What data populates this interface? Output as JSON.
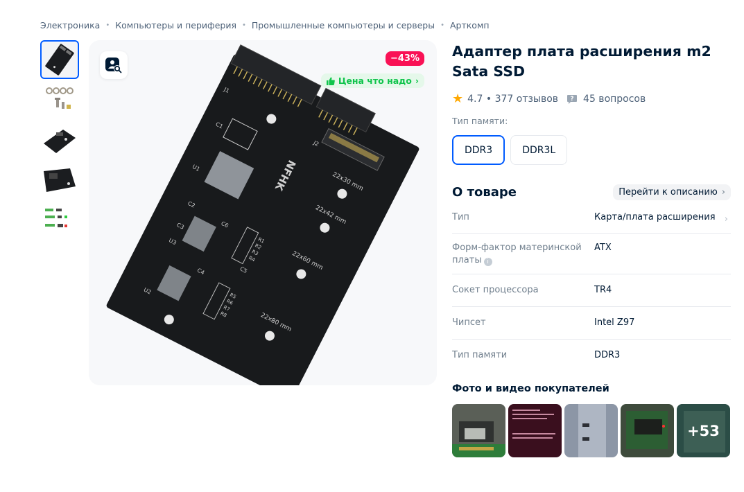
{
  "breadcrumb": [
    "Электроника",
    "Компьютеры и периферия",
    "Промышленные компьютеры и серверы",
    "Арткомп"
  ],
  "gallery": {
    "discount": "−43%",
    "good_price": "Цена что надо",
    "thumbnails": [
      "adapter-board",
      "screws",
      "board-angle-1",
      "board-angle-2",
      "compatibility-chart"
    ],
    "board_labels": [
      "NFHK",
      "22x30 mm",
      "22x42 mm",
      "22x60 mm",
      "22x80 mm",
      "J1",
      "J2",
      "C1",
      "C2",
      "C3",
      "C4",
      "C5",
      "C6",
      "U1",
      "U2",
      "U3",
      "R1",
      "R2",
      "R3",
      "R4",
      "R5",
      "R6",
      "R7",
      "R8"
    ]
  },
  "product": {
    "title": "Адаптер плата расширения m2 Sata SSD",
    "rating": "4.7",
    "reviews": "377 отзывов",
    "questions": "45 вопросов",
    "memory_label": "Тип памяти:",
    "variants": [
      "DDR3",
      "DDR3L"
    ]
  },
  "about": {
    "title": "О товаре",
    "to_description": "Перейти к описанию",
    "specs": [
      {
        "key": "Тип",
        "value": "Карта/плата расширения"
      },
      {
        "key": "Форм-фактор материнской платы",
        "value": "ATX"
      },
      {
        "key": "Сокет процессора",
        "value": "TR4"
      },
      {
        "key": "Чипсет",
        "value": "Intel Z97"
      },
      {
        "key": "Тип памяти",
        "value": "DDR3"
      }
    ]
  },
  "ugc": {
    "title": "Фото и видео покупателей",
    "more": "+53"
  },
  "colors": {
    "accent": "#005bff",
    "discount": "#f91155",
    "good_price": "#10c44c",
    "star": "#ffa800"
  }
}
